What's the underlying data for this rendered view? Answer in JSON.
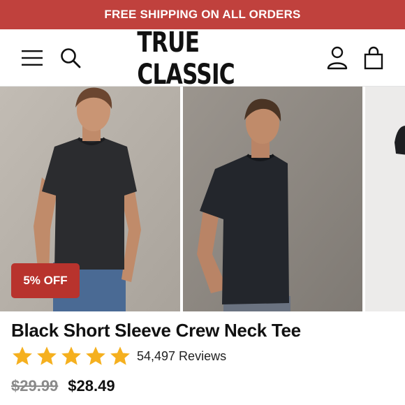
{
  "promo": {
    "text": "FREE SHIPPING ON ALL ORDERS"
  },
  "header": {
    "logo": "TRUE CLASSIC",
    "icons": [
      "menu-icon",
      "search-icon",
      "account-icon",
      "cart-icon"
    ]
  },
  "gallery": {
    "badge": "5% OFF"
  },
  "product": {
    "title": "Black Short Sleeve Crew Neck Tee",
    "rating": 5,
    "reviews": "54,497 Reviews",
    "price_old": "$29.99",
    "price_new": "$28.49"
  },
  "colors": {
    "promo_bg": "#c0413d",
    "badge_bg": "#b8332d",
    "star": "#f5b01f",
    "text": "#111111",
    "muted": "#8a8a8a"
  }
}
